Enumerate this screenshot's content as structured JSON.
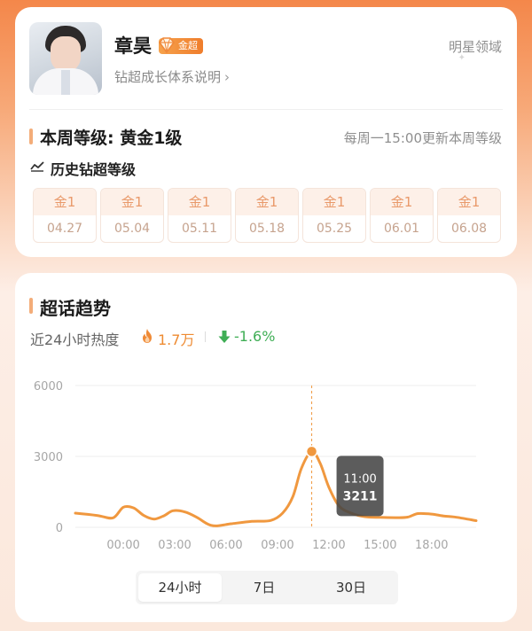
{
  "profile": {
    "name": "章昊",
    "badge": "金超",
    "growth_link": "钻超成长体系说明",
    "domain": "明星领域"
  },
  "level": {
    "title": "本周等级: 黄金1级",
    "update_note": "每周一15:00更新本周等级",
    "history_label": "历史钻超等级",
    "weeks": [
      {
        "level": "金1",
        "date": "04.27"
      },
      {
        "level": "金1",
        "date": "05.04"
      },
      {
        "level": "金1",
        "date": "05.11"
      },
      {
        "level": "金1",
        "date": "05.18"
      },
      {
        "level": "金1",
        "date": "05.25"
      },
      {
        "level": "金1",
        "date": "06.01"
      },
      {
        "level": "金1",
        "date": "06.08"
      }
    ]
  },
  "trend": {
    "title": "超话趋势",
    "subtitle": "近24小时热度",
    "heat": "1.7万",
    "change": "-1.6%",
    "tabs": [
      "24小时",
      "7日",
      "30日"
    ],
    "active_tab": 0
  },
  "colors": {
    "line": "#f0983f",
    "up": "#3fae55",
    "accent": "#ee8b32"
  },
  "chart_data": {
    "type": "line",
    "x_ticks": [
      "00:00",
      "03:00",
      "06:00",
      "09:00",
      "12:00",
      "15:00",
      "18:00"
    ],
    "y_ticks": [
      "0",
      "3000",
      "6000"
    ],
    "ylim": [
      0,
      6000
    ],
    "xlim_hours": [
      -2.8,
      20.6
    ],
    "grid": true,
    "series": [
      {
        "x_hours": [
          -2.8,
          -1.5,
          -0.6,
          0.0,
          0.6,
          1.2,
          1.8,
          2.4,
          2.9,
          3.6,
          4.3,
          4.9,
          5.4,
          6.3,
          7.5,
          8.6,
          9.3,
          9.9,
          10.4,
          11.0,
          11.5,
          12.0,
          12.6,
          13.3,
          14.1,
          15.0,
          15.9,
          16.6,
          17.2,
          18.0,
          18.7,
          19.5,
          20.6
        ],
        "y": [
          600,
          500,
          400,
          850,
          820,
          500,
          350,
          500,
          700,
          650,
          420,
          150,
          60,
          150,
          250,
          290,
          600,
          1300,
          2500,
          3211,
          2700,
          1700,
          900,
          600,
          450,
          420,
          410,
          430,
          580,
          560,
          480,
          420,
          280
        ]
      }
    ],
    "tooltip": {
      "time": "11:00",
      "value": "3211"
    }
  }
}
